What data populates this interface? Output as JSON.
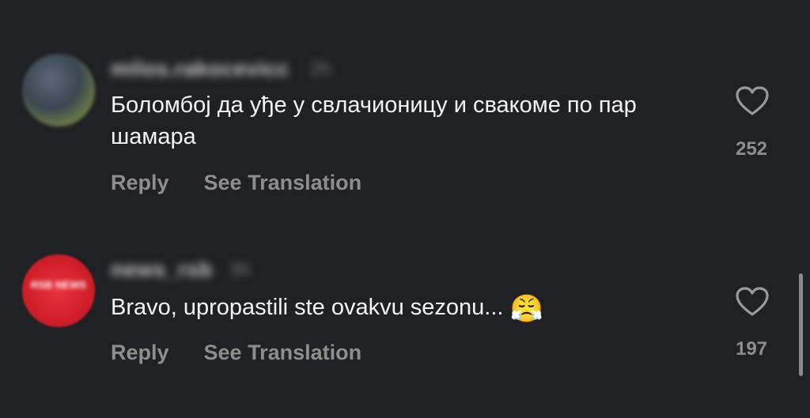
{
  "comments": [
    {
      "username": "milos.rakocevicc",
      "time": "2h",
      "text": "Боломбој да уђе у свлачионицу и свакоме по пар шамара",
      "reply_label": "Reply",
      "translate_label": "See Translation",
      "likes": "252",
      "avatar_icon": "user-avatar-photo"
    },
    {
      "username": "news_rsb",
      "time": "3h",
      "text": "Bravo, upropastili ste ovakvu sezonu...",
      "emoji": "😤",
      "reply_label": "Reply",
      "translate_label": "See Translation",
      "likes": "197",
      "avatar_text": "RSB NEWS",
      "avatar_icon": "news-logo-avatar"
    }
  ],
  "colors": {
    "background": "#202124",
    "text": "#f4f4f4",
    "muted": "#8e8e8e",
    "news_red": "#d01f2a"
  }
}
